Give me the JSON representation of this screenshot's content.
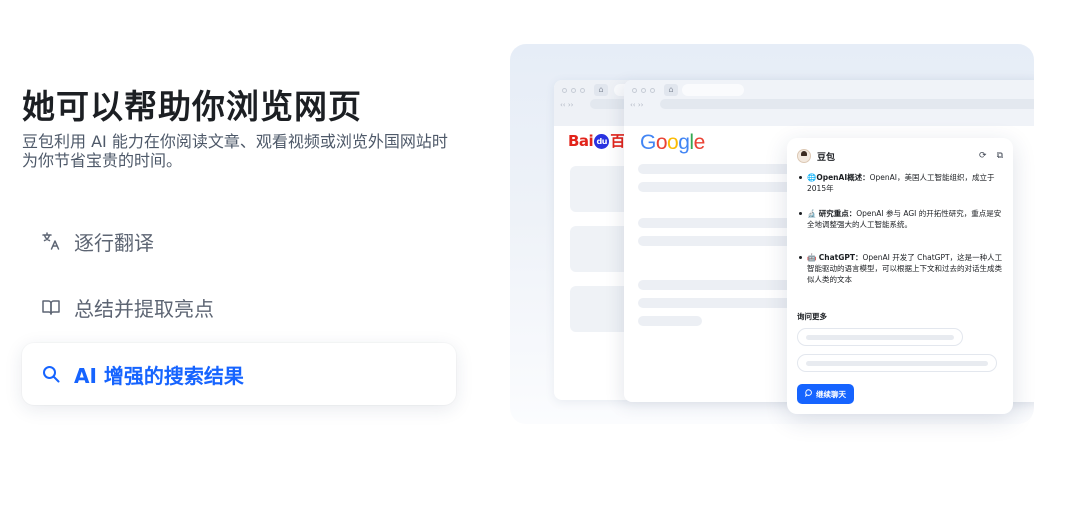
{
  "hero": {
    "title": "她可以帮助你浏览网页",
    "description": "豆包利用 AI 能力在你阅读文章、观看视频或浏览外国网站时为你节省宝贵的时间。"
  },
  "features": [
    {
      "label": "逐行翻译",
      "icon": "translate-icon",
      "active": false
    },
    {
      "label": "总结并提取亮点",
      "icon": "book-icon",
      "active": false
    },
    {
      "label": "AI 增强的搜索结果",
      "icon": "search-icon",
      "active": true
    }
  ],
  "colors": {
    "accent": "#1664ff",
    "text": "#1c1f23",
    "muted": "#5d6573"
  },
  "browser": {
    "baidu_logo_left": "Bai",
    "baidu_logo_paw": "du",
    "baidu_logo_right": "百",
    "google_letters": [
      "G",
      "o",
      "o",
      "g",
      "l",
      "e"
    ],
    "google_colors": [
      "#4285f4",
      "#ea4335",
      "#fbbc05",
      "#4285f4",
      "#34a853",
      "#ea4335"
    ]
  },
  "assistant": {
    "title": "豆包",
    "icons": [
      "refresh-icon",
      "copy-icon"
    ],
    "bullets": [
      {
        "emoji": "🌐",
        "heading": "OpenAI概述",
        "text": "OpenAI，美国人工智能组织，成立于2015年"
      },
      {
        "emoji": "🔬",
        "heading": "研究重点",
        "text": "OpenAI 参与 AGI 的开拓性研究，重点是安全地调整强大的人工智能系统。"
      },
      {
        "emoji": "🤖",
        "heading": "ChatGPT",
        "text": "OpenAI 开发了 ChatGPT，这是一种人工智能驱动的语言模型，可以根据上下文和过去的对话生成类似人类的文本"
      }
    ],
    "more_label": "询问更多",
    "continue_label": "继续聊天"
  }
}
